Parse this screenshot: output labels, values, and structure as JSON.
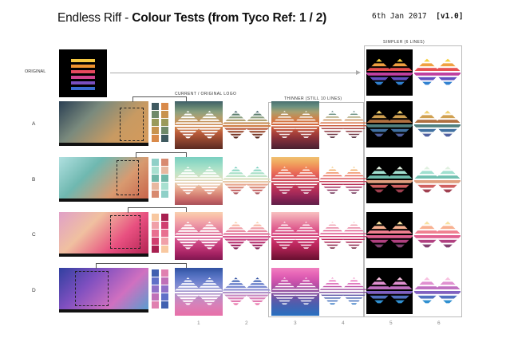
{
  "header": {
    "title_prefix": "Endless Riff - ",
    "title_bold": "Colour Tests (from Tyco Ref: 1 / 2)",
    "date": "6th Jan 2017",
    "version": "[v1.0]"
  },
  "labels": {
    "original": "ORIGINAL",
    "current": "CURRENT / ORIGINAL LOGO",
    "thinner": "THINNER (STILL 10 LINES)",
    "simpler": "SIMPLER (6 LINES)"
  },
  "rows": [
    {
      "id": "A",
      "photo": [
        "#2a3f53",
        "#7a8a7d",
        "#c89a62",
        "#d69a5a"
      ],
      "swatches": [
        "#3f5a60",
        "#6f8a6a",
        "#9a9a5a",
        "#c8934e",
        "#d98a4a"
      ],
      "logo": [
        "#3f5f68",
        "#5f8070",
        "#8aa080",
        "#b0a070",
        "#c89058",
        "#d08048",
        "#b85a3a",
        "#9a4a30",
        "#7a3a2a",
        "#5a2a20"
      ],
      "thin": [
        "#4a7070",
        "#6a9080",
        "#a8a070",
        "#c88850",
        "#d87040",
        "#c8583a",
        "#a8403a",
        "#883038",
        "#682838",
        "#482030"
      ]
    },
    {
      "id": "B",
      "photo": [
        "#b0e0e0",
        "#6fb8b0",
        "#d89a70",
        "#c86048"
      ],
      "swatches": [
        "#8fd0c8",
        "#a8e0d0",
        "#70b8a8",
        "#e8b8a0",
        "#d88a70"
      ],
      "logo": [
        "#7acfc0",
        "#8fd8c4",
        "#a8e0c8",
        "#c0e4c8",
        "#d8e0c0",
        "#e8c8a8",
        "#e8a890",
        "#d88878",
        "#c86868",
        "#a85058"
      ],
      "thin": [
        "#f0c070",
        "#f0a860",
        "#f08858",
        "#e86858",
        "#d85058",
        "#c84058",
        "#b83058",
        "#a02858",
        "#802050",
        "#602048"
      ]
    },
    {
      "id": "C",
      "photo": [
        "#e0a0c8",
        "#f0c0a0",
        "#e85080",
        "#b02050"
      ],
      "swatches": [
        "#f8c8a0",
        "#f0a0a8",
        "#e87090",
        "#d04070",
        "#a82050"
      ],
      "logo": [
        "#f8d0b0",
        "#f8b8a8",
        "#f0a0a8",
        "#e888a0",
        "#e07098",
        "#d85890",
        "#c84080",
        "#b83070",
        "#a02060",
        "#801850"
      ],
      "thin": [
        "#f8c0c0",
        "#f0a0b0",
        "#e880a0",
        "#e06090",
        "#d84880",
        "#d03870",
        "#c02860",
        "#a82050",
        "#881840",
        "#681030"
      ]
    },
    {
      "id": "D",
      "photo": [
        "#3040a0",
        "#8050c0",
        "#d070c0",
        "#50a0d0"
      ],
      "swatches": [
        "#4060b0",
        "#6070c8",
        "#9070c8",
        "#c070b8",
        "#e080b0"
      ],
      "logo": [
        "#3050a0",
        "#4868b8",
        "#6078c8",
        "#7888d0",
        "#9090d0",
        "#b090c8",
        "#c888c0",
        "#d880b8",
        "#e078b0",
        "#e870a8"
      ],
      "thin": [
        "#f080c0",
        "#e868b8",
        "#d858b0",
        "#c050a8",
        "#a050a0",
        "#8050a0",
        "#6058a8",
        "#4860b0",
        "#3868b8",
        "#2870c0"
      ]
    }
  ],
  "simpler_rows": [
    [
      "#f5d040",
      "#f0a040",
      "#e85050",
      "#c040a0",
      "#6050c0",
      "#3080d0"
    ],
    [
      "#f0d070",
      "#d0a050",
      "#b07040",
      "#508080",
      "#4070a0",
      "#5060a0"
    ],
    [
      "#e0f0e0",
      "#a0e0d0",
      "#70c0b0",
      "#e0a080",
      "#d06060",
      "#a04050"
    ],
    [
      "#f8e0a0",
      "#f8b090",
      "#f08090",
      "#e06090",
      "#b04080",
      "#804070"
    ],
    [
      "#f8c0e0",
      "#e090d0",
      "#c070c0",
      "#8060c0",
      "#5070c0",
      "#3090d0"
    ]
  ],
  "original_bars": [
    "#f5c842",
    "#f0932f",
    "#e84a5f",
    "#d2448e",
    "#7a4fc0",
    "#3a6bd1"
  ],
  "column_numbers": [
    "1",
    "2",
    "3",
    "4",
    "5",
    "6"
  ]
}
